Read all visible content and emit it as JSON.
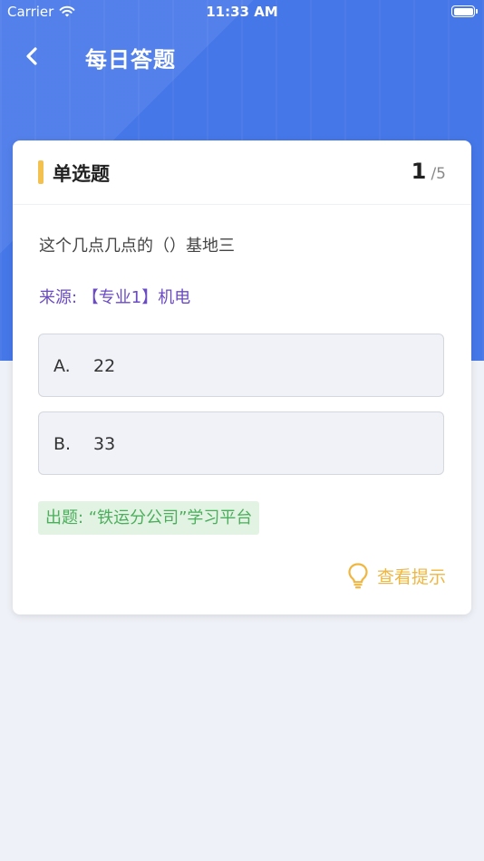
{
  "status_bar": {
    "carrier": "Carrier",
    "time": "11:33 AM"
  },
  "nav": {
    "title": "每日答题",
    "back_icon": "chevron-left-icon"
  },
  "question_card": {
    "type_label": "单选题",
    "progress": {
      "current": "1",
      "total": "/5"
    },
    "question_text": "这个几点几点的（）基地三",
    "source": "来源: 【专业1】机电",
    "options": [
      {
        "key": "A.",
        "value": "22"
      },
      {
        "key": "B.",
        "value": "33"
      }
    ],
    "issuer": "出题: “铁运分公司”学习平台",
    "hint": {
      "label": "查看提示",
      "icon": "lightbulb-icon"
    }
  },
  "colors": {
    "header_blue": "#4677e8",
    "accent_yellow": "#f2c14f",
    "source_purple": "#6a4bc4",
    "issuer_green": "#4cae5c",
    "hint_orange": "#efb640"
  }
}
